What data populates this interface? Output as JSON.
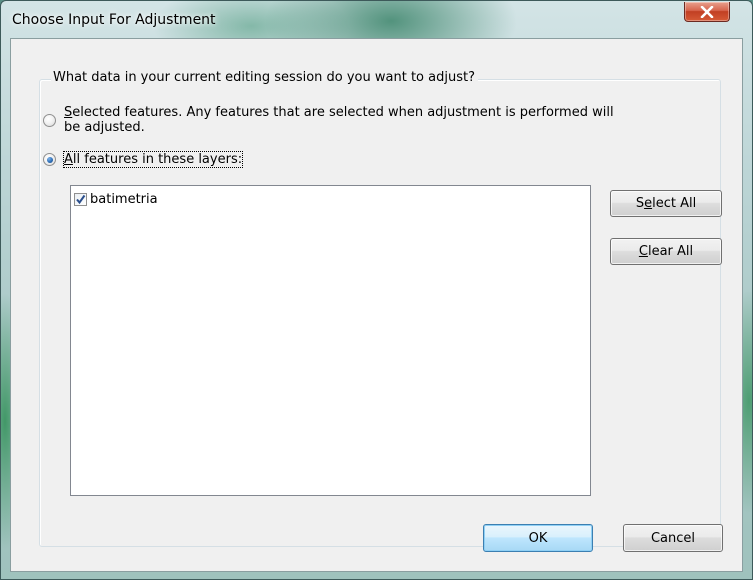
{
  "window": {
    "title": "Choose Input For Adjustment",
    "close_icon": "close-icon"
  },
  "group": {
    "legend": "What data in your current editing session do you want to adjust?"
  },
  "options": {
    "selected_features": {
      "mnemonic": "S",
      "label_rest": "elected features.  Any features that are selected when adjustment is performed will",
      "label_line2": "be adjusted.",
      "checked": false
    },
    "all_features": {
      "mnemonic": "A",
      "label_rest": "ll features in these layers:",
      "checked": true
    }
  },
  "layers": {
    "items": [
      {
        "label": "batimetria",
        "checked": true
      }
    ]
  },
  "buttons": {
    "select_all": {
      "pre": "S",
      "mnemonic": "e",
      "post": "lect All"
    },
    "clear_all": {
      "pre": "",
      "mnemonic": "C",
      "post": "lear All"
    },
    "ok": "OK",
    "cancel": "Cancel"
  }
}
